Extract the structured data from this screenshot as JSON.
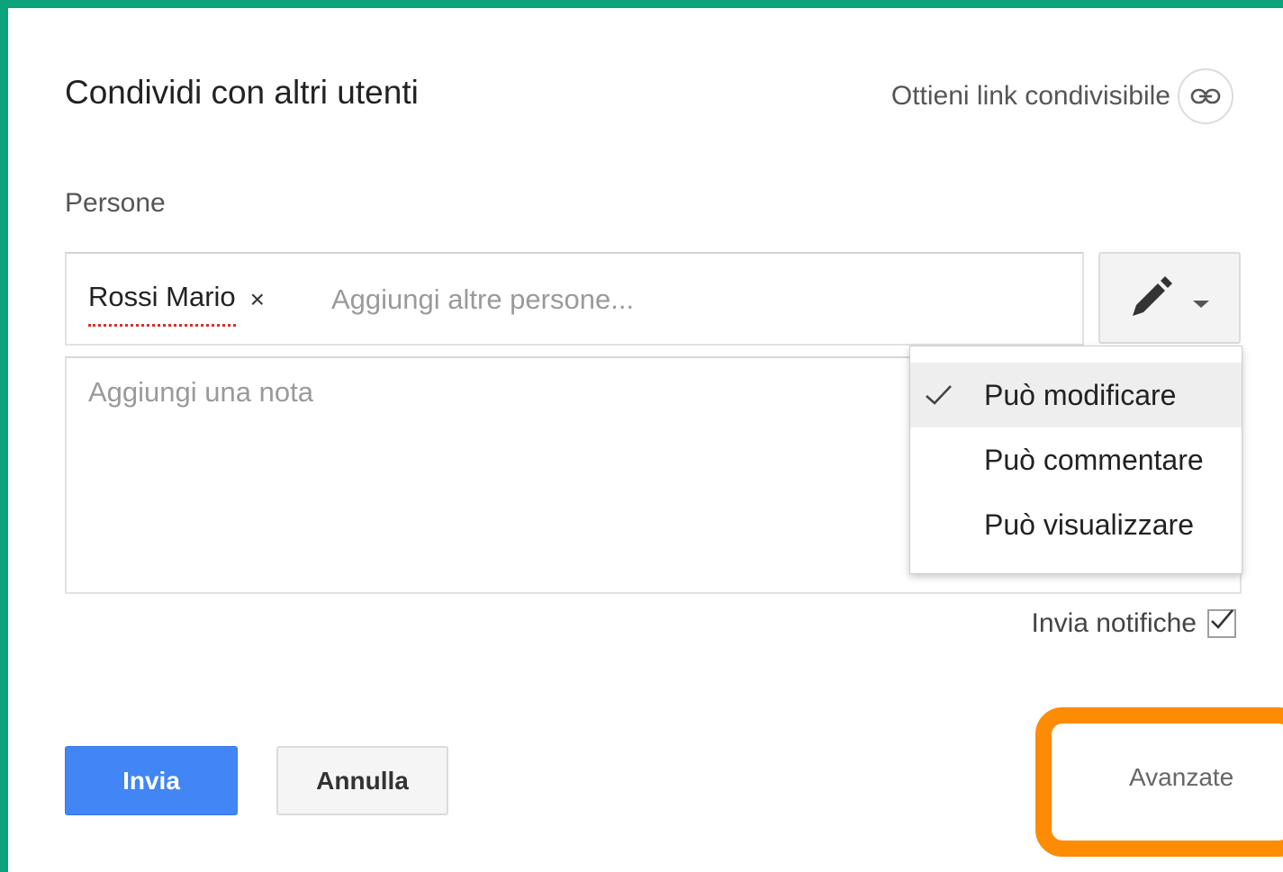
{
  "dialog": {
    "title": "Condividi con altri utenti",
    "share_link_label": "Ottieni link condivisibile",
    "share_link_icon": "link-icon"
  },
  "people": {
    "label": "Persone",
    "chips": [
      {
        "name": "Rossi Mario",
        "remove_symbol": "×"
      }
    ],
    "placeholder": "Aggiungi altre persone...",
    "permission_button_icon": "pencil-icon",
    "permission_dropdown_icon": "chevron-down-icon"
  },
  "note": {
    "placeholder": "Aggiungi una nota"
  },
  "permission_menu": {
    "items": [
      {
        "label": "Può modificare",
        "selected": true
      },
      {
        "label": "Può commentare",
        "selected": false
      },
      {
        "label": "Può visualizzare",
        "selected": false
      }
    ]
  },
  "notify": {
    "label": "Invia notifiche",
    "checked": true
  },
  "actions": {
    "send_label": "Invia",
    "cancel_label": "Annulla",
    "advanced_label": "Avanzate"
  },
  "colors": {
    "frame": "#0aa37c",
    "primary_button": "#4285f4",
    "highlight": "#fd8c04"
  }
}
